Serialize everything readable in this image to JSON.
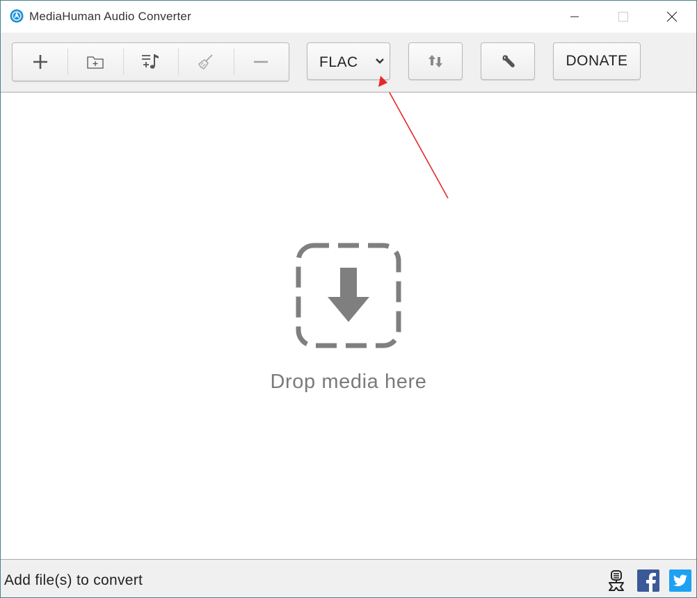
{
  "window": {
    "title": "MediaHuman Audio Converter"
  },
  "toolbar": {
    "buttons": [
      {
        "name": "add-files",
        "icon": "plus-icon"
      },
      {
        "name": "add-folder",
        "icon": "folder-plus-icon"
      },
      {
        "name": "add-itunes-playlist",
        "icon": "playlist-add-icon"
      },
      {
        "name": "clear-list",
        "icon": "broom-icon"
      },
      {
        "name": "remove-selected",
        "icon": "minus-icon"
      }
    ],
    "format": {
      "selected": "FLAC",
      "icon": "chevron-down-icon"
    },
    "convert_icon": "convert-arrows-icon",
    "settings_icon": "wrench-icon",
    "donate_label": "DONATE"
  },
  "main": {
    "drop_icon": "download-arrow-icon",
    "drop_text": "Drop media here"
  },
  "statusbar": {
    "status_text": "Add file(s) to convert",
    "icons": [
      "support-icon",
      "facebook-icon",
      "twitter-icon"
    ]
  },
  "colors": {
    "accent_icon": "#1e90d6",
    "drop_gray": "#7f7f7f",
    "annotation_red": "#e8262b",
    "facebook_blue": "#3b5998",
    "twitter_blue": "#1da1f2",
    "window_border": "#4a7f8a"
  }
}
